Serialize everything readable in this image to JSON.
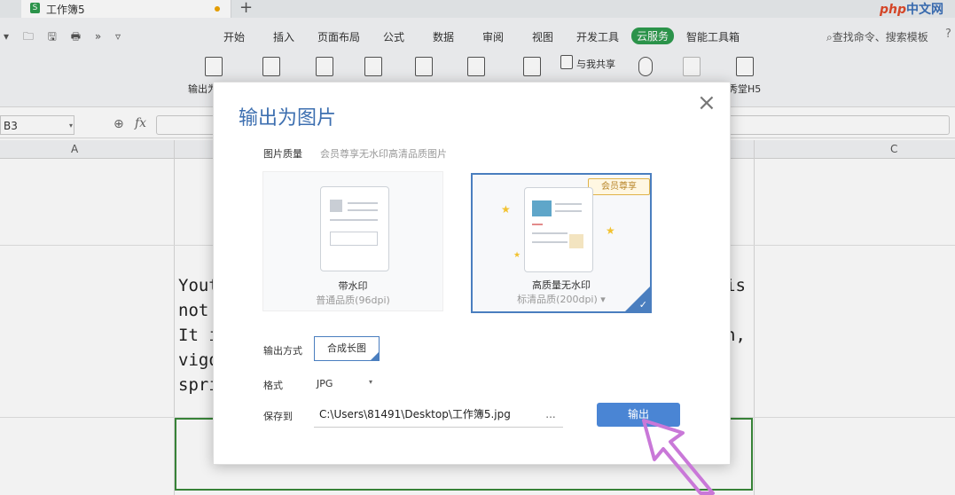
{
  "tabbar": {
    "doc_title": "工作簿5",
    "add": "+",
    "brand_php": "php",
    "brand_site": "中文网"
  },
  "menubar": {
    "quick_icons": "▾ 🗀 🖫 🖶 » ▿",
    "items": [
      "开始",
      "插入",
      "页面布局",
      "公式",
      "数据",
      "审阅",
      "视图",
      "开发工具",
      "云服务",
      "智能工具箱"
    ],
    "active": "云服务",
    "search": "查找命令、搜索模板",
    "help": "?"
  },
  "ribbon": {
    "labels": {
      "export_left": "输出为",
      "share": "与我共享",
      "show_h5": "秀堂H5"
    }
  },
  "formula_bar": {
    "cell_ref": "B3",
    "fx": "fx"
  },
  "sheet": {
    "columns": [
      "A",
      "C"
    ],
    "cell_lines": [
      "Yout",
      "not ",
      "It i",
      "vigo",
      "spri"
    ],
    "cell_right": [
      "is",
      "",
      "n,",
      "",
      ""
    ]
  },
  "dialog": {
    "title": "输出为图片",
    "close": "×",
    "quality_label": "图片质量",
    "quality_hint": "会员尊享无水印高清品质图片",
    "option1": {
      "title": "带水印",
      "sub": "普通品质(96dpi)"
    },
    "option2": {
      "title": "高质量无水印",
      "sub": "标清品质(200dpi)",
      "badge": "会员尊享",
      "selected": true
    },
    "mode_label": "输出方式",
    "mode_value": "合成长图",
    "format_label": "格式",
    "format_value": "JPG",
    "save_label": "保存到",
    "save_path": "C:\\Users\\81491\\Desktop\\工作簿5.jpg",
    "browse": "...",
    "export_button": "输出"
  },
  "colors": {
    "accent": "#4a85d4",
    "title_blue": "#3d6fb0",
    "active_tab": "#2e9b4e",
    "arrow": "#c978d8"
  }
}
